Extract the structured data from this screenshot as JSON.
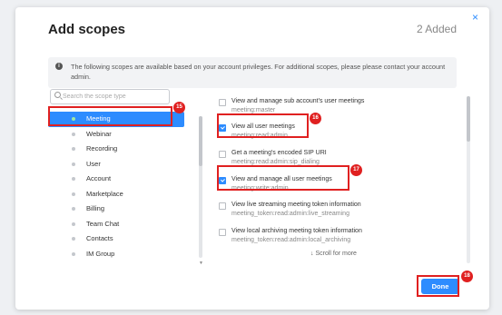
{
  "dialog": {
    "title": "Add scopes",
    "added_count": "2 Added",
    "close_glyph": "×",
    "info_icon": "info-icon",
    "info_text": "The following scopes are available based on your account privileges. For additional scopes, please please contact your account admin."
  },
  "search": {
    "placeholder": "Search the scope type"
  },
  "categories": [
    {
      "label": "Meeting",
      "active": true
    },
    {
      "label": "Webinar"
    },
    {
      "label": "Recording"
    },
    {
      "label": "User"
    },
    {
      "label": "Account"
    },
    {
      "label": "Marketplace"
    },
    {
      "label": "Billing"
    },
    {
      "label": "Team Chat"
    },
    {
      "label": "Contacts"
    },
    {
      "label": "IM Group"
    }
  ],
  "scopes": [
    {
      "name": "View and manage sub account's user meetings",
      "code": "meeting:master",
      "checked": false
    },
    {
      "name": "View all user meetings",
      "code": "meeting:read:admin",
      "checked": true
    },
    {
      "name": "Get a meeting's encoded SIP URI",
      "code": "meeting:read:admin:sip_dialing",
      "checked": false
    },
    {
      "name": "View and manage all user meetings",
      "code": "meeting:write:admin",
      "checked": true
    },
    {
      "name": "View live streaming meeting token information",
      "code": "meeting_token:read:admin:live_streaming",
      "checked": false
    },
    {
      "name": "View local archiving meeting token information",
      "code": "meeting_token:read:admin:local_archiving",
      "checked": false
    }
  ],
  "scroll_more": "↓ Scroll for more",
  "done_label": "Done",
  "annotations": {
    "a15": "15",
    "a16": "16",
    "a17": "17",
    "a18": "18"
  },
  "colors": {
    "accent": "#2d8cff",
    "annotation": "#e02020"
  }
}
